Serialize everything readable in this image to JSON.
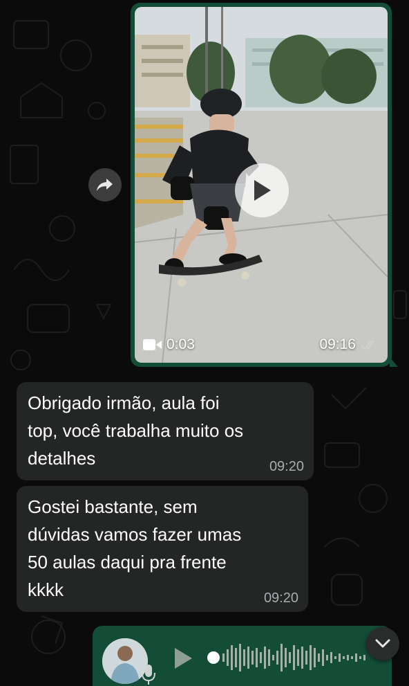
{
  "chat": {
    "video_message": {
      "duration": "0:03",
      "time": "09:16",
      "status": "read",
      "icons": [
        "video-camera-icon",
        "play-icon",
        "double-check-icon"
      ]
    },
    "forward": {
      "icon": "forward-arrow-icon"
    },
    "messages": [
      {
        "text": "Obrigado irmão, aula foi\ntop, você trabalha muito os\ndetalhes",
        "time": "09:20"
      },
      {
        "text": "Gostei bastante, sem\ndúvidas vamos fazer umas\n50 aulas daqui pra frente\nkkkk",
        "time": "09:20"
      }
    ],
    "voice_message": {
      "icons": [
        "avatar",
        "microphone-icon",
        "play-icon",
        "waveform"
      ]
    },
    "scroll_down": {
      "icon": "chevron-down-icon"
    }
  },
  "colors": {
    "background": "#0b0b0b",
    "incoming_bubble": "#242626",
    "outgoing_bubble": "#144d37",
    "timestamp": "#a7aeb0"
  }
}
